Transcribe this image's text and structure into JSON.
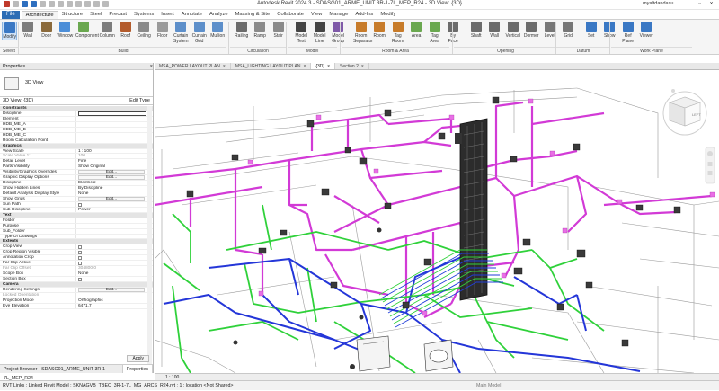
{
  "window": {
    "title": "Autodesk Revit 2024.3 - SDASG01_ARME_UNIT 3R-1-7L_MEP_R24 - 3D View: {3D}",
    "user": "myaltdandasu..."
  },
  "ribbon_tabs": [
    "File",
    "Architecture",
    "Structure",
    "Steel",
    "Precast",
    "Systems",
    "Insert",
    "Annotate",
    "Analyze",
    "Massing & Site",
    "Collaborate",
    "View",
    "Manage",
    "Add-Ins",
    "Modify"
  ],
  "ribbon_active_tab": "Architecture",
  "ribbon_tools": [
    {
      "label": "Modify"
    },
    {
      "label": "Wall"
    },
    {
      "label": "Door"
    },
    {
      "label": "Window"
    },
    {
      "label": "Component"
    },
    {
      "label": "Column"
    },
    {
      "label": "Roof"
    },
    {
      "label": "Ceiling"
    },
    {
      "label": "Floor"
    },
    {
      "label": "Curtain System"
    },
    {
      "label": "Curtain Grid"
    },
    {
      "label": "Mullion"
    },
    {
      "label": "Railing"
    },
    {
      "label": "Ramp"
    },
    {
      "label": "Stair"
    },
    {
      "label": "Model Text"
    },
    {
      "label": "Model Line"
    },
    {
      "label": "Model Group"
    },
    {
      "label": "Room Separator"
    },
    {
      "label": "Room"
    },
    {
      "label": "Tag Room"
    },
    {
      "label": "Area"
    },
    {
      "label": "Tag Area"
    },
    {
      "label": "By Face"
    },
    {
      "label": "Shaft"
    },
    {
      "label": "Wall"
    },
    {
      "label": "Vertical"
    },
    {
      "label": "Dormer"
    },
    {
      "label": "Level"
    },
    {
      "label": "Grid"
    },
    {
      "label": "Set"
    },
    {
      "label": "Show"
    },
    {
      "label": "Ref Plane"
    },
    {
      "label": "Viewer"
    }
  ],
  "ribbon_groups": [
    "Select",
    "Build",
    "Circulation",
    "Model",
    "Room & Area",
    "Opening",
    "Datum",
    "Work Plane"
  ],
  "view_tabs": [
    {
      "label": "MSA_POWER LAYOUT PLAN",
      "active": false
    },
    {
      "label": "MSA_LIGHTING LAYOUT PLAN",
      "active": false
    },
    {
      "label": "{3D}",
      "active": true
    },
    {
      "label": "Section 2",
      "active": false
    }
  ],
  "properties": {
    "header": "Properties",
    "type_name": "3D View",
    "filter_label": "3D View: {3D}",
    "edit_type": "Edit Type",
    "apply": "Apply",
    "rows": [
      {
        "g": "Constraints"
      },
      {
        "k": "Discipline",
        "v": "",
        "box": true
      },
      {
        "k": "Element",
        "v": ""
      },
      {
        "k": "HDB_ME_A",
        "v": ""
      },
      {
        "k": "HDB_ME_B",
        "v": ""
      },
      {
        "k": "HDB_ME_C",
        "v": ""
      },
      {
        "k": "Room Calculation Point",
        "v": ""
      },
      {
        "g": "Graphics"
      },
      {
        "k": "View Scale",
        "v": "1 : 100"
      },
      {
        "k": "Scale Value 1:",
        "v": "100",
        "dim": true
      },
      {
        "k": "Detail Level",
        "v": "Fine"
      },
      {
        "k": "Parts Visibility",
        "v": "Show Original"
      },
      {
        "k": "Visibility/Graphics Overrides",
        "v": "Edit...",
        "btn": true
      },
      {
        "k": "Graphic Display Options",
        "v": "Edit...",
        "btn": true
      },
      {
        "k": "Discipline",
        "v": "Electrical"
      },
      {
        "k": "Show Hidden Lines",
        "v": "By Discipline"
      },
      {
        "k": "Default Analysis Display Style",
        "v": "None"
      },
      {
        "k": "Show Grids",
        "v": "Edit...",
        "btn": true
      },
      {
        "k": "Sun Path",
        "v": "",
        "chk": true
      },
      {
        "k": "Sub-Discipline",
        "v": "Power"
      },
      {
        "g": "Text"
      },
      {
        "k": "Folder",
        "v": ""
      },
      {
        "k": "Purpose",
        "v": ""
      },
      {
        "k": "Sub_Folder",
        "v": ""
      },
      {
        "k": "Type Of Drawings",
        "v": ""
      },
      {
        "g": "Extents"
      },
      {
        "k": "Crop View",
        "v": "",
        "chk": true
      },
      {
        "k": "Crop Region Visible",
        "v": "",
        "chk": true
      },
      {
        "k": "Annotation Crop",
        "v": "",
        "chk": true
      },
      {
        "k": "Far Clip Active",
        "v": "",
        "chk": true
      },
      {
        "k": "Far Clip Offset",
        "v": "304800.0",
        "dim": true
      },
      {
        "k": "Scope Box",
        "v": "None"
      },
      {
        "k": "Section Box",
        "v": "",
        "chk": true
      },
      {
        "g": "Camera"
      },
      {
        "k": "Rendering Settings",
        "v": "Edit...",
        "btn": true
      },
      {
        "k": "Locked Orientation",
        "v": "",
        "dim": true
      },
      {
        "k": "Projection Mode",
        "v": "Orthographic"
      },
      {
        "k": "Eye Elevation",
        "v": "6471.7"
      }
    ]
  },
  "footer_tabs": [
    "Project Browser - SDASG01_ARME_UNIT 3R-1-7L_MEP_R24",
    "Properties"
  ],
  "view_control": {
    "scale": "1 : 100"
  },
  "statusbar": {
    "text": "RVT Links : Linked Revit Model : SKNAGVB_TBEC_3R-1-7L_MG_ARCS_R24.rvt : 1 : location <Not Shared>",
    "main_model": "Main Model"
  },
  "viewcube": {
    "face": "LEFT"
  },
  "colors": {
    "ribbon_file": "#2d6db5",
    "pipe_magenta": "#d23ad6",
    "pipe_green": "#2fd13a",
    "pipe_blue": "#2436d8",
    "riser": "#2c2c2c"
  }
}
